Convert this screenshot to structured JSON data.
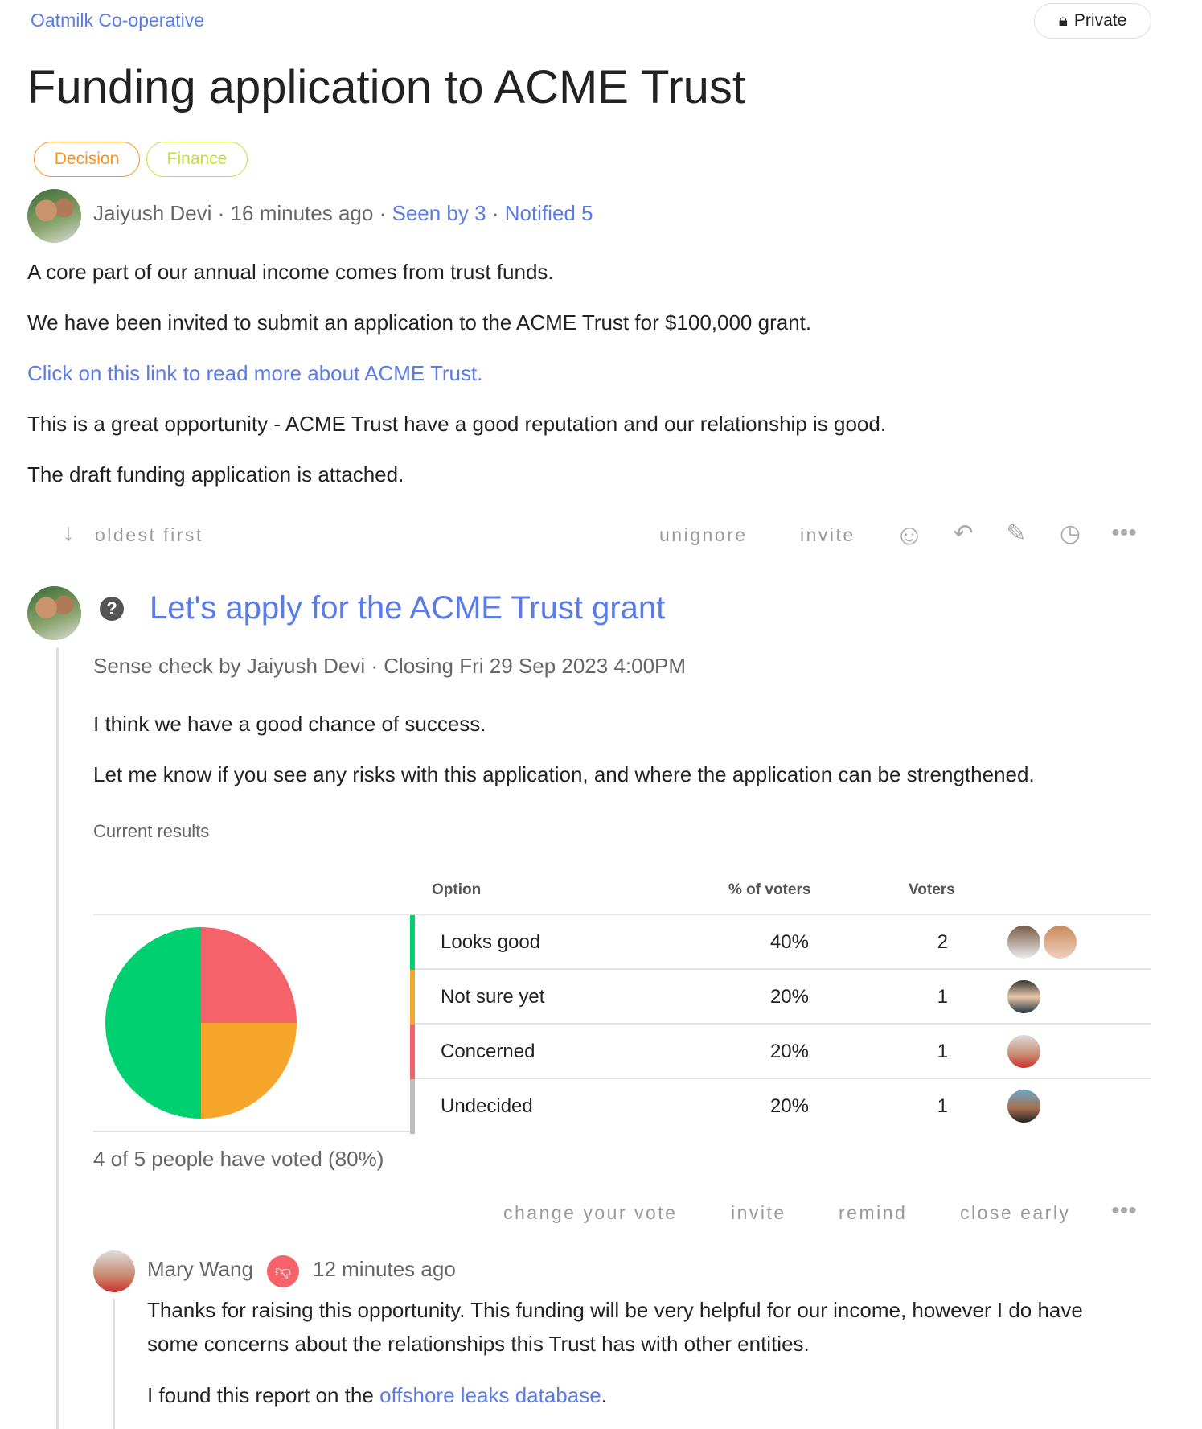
{
  "group_name": "Oatmilk Co-operative",
  "privacy": {
    "label": "Private",
    "icon": "lock-icon"
  },
  "title": "Funding application to ACME Trust",
  "tags": [
    {
      "label": "Decision",
      "color": "#f7931e"
    },
    {
      "label": "Finance",
      "color": "#c6dc3c"
    }
  ],
  "meta": {
    "author": "Jaiyush Devi",
    "time": "16 minutes ago",
    "seen": "Seen by 3",
    "notified": "Notified 5",
    "sep": "·"
  },
  "body": [
    "A core part of our annual income comes from trust funds.",
    "We have been invited to submit an application to the ACME Trust for $100,000 grant.",
    "Click on this link to read more about ACME Trust.",
    "This is a great opportunity - ACME Trust have a good reputation and our relationship is good.",
    "The draft funding application is attached."
  ],
  "actions": {
    "sort": "oldest first",
    "unignore": "unignore",
    "invite": "invite",
    "icons": [
      "smiley-icon",
      "reply-icon",
      "edit-icon",
      "history-icon",
      "more-icon"
    ]
  },
  "poll": {
    "title": "Let's apply for the ACME Trust grant",
    "meta": "Sense check by Jaiyush Devi · Closing Fri 29 Sep 2023 4:00PM",
    "body": [
      "I think we have a good chance of success.",
      "Let me know if you see any risks with this application, and where the application can be strengthened."
    ],
    "results_label": "Current results",
    "headers": {
      "option": "Option",
      "pct": "% of voters",
      "voters": "Voters"
    },
    "summary": "4 of 5 people have voted (80%)",
    "actions": {
      "change": "change your vote",
      "invite": "invite",
      "remind": "remind",
      "close": "close early"
    }
  },
  "chart_data": {
    "type": "pie",
    "categories": [
      "Looks good",
      "Not sure yet",
      "Concerned",
      "Undecided"
    ],
    "values": [
      2,
      1,
      1,
      1
    ],
    "percent": [
      "40%",
      "20%",
      "20%",
      "20%"
    ],
    "colors": [
      "#00d070",
      "#f6a72b",
      "#f6626a",
      "#bdbdbd"
    ],
    "pie_excludes": [
      "Undecided"
    ]
  },
  "comment": {
    "author": "Mary Wang",
    "time": "12 minutes ago",
    "stance_icon": "thumbs-down-icon",
    "body1": "Thanks for raising this opportunity. This funding will be very helpful for our income, however I do have",
    "body2": "some concerns about the relationships this Trust has with other entities.",
    "body3_pre": "I found this report on the ",
    "body3_link": "offshore leaks database",
    "body3_post": "."
  }
}
